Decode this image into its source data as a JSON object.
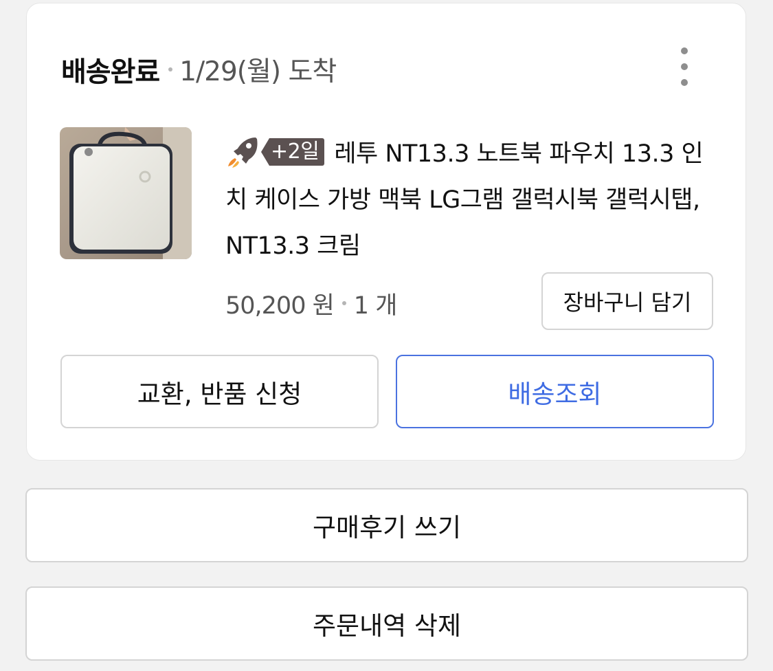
{
  "order": {
    "status": "배송완료",
    "arrival": "1/29(월) 도착",
    "more_icon": "more-vertical-icon"
  },
  "product": {
    "image_icon": "product-thumbnail",
    "rocket_icon": "rocket-icon",
    "badge": "+2일",
    "title": "레투 NT13.3 노트북 파우치 13.3 인치 케이스 가방 맥북 LG그램 갤럭시북 갤럭시탭, NT13.3 크림",
    "price": "50,200 원",
    "quantity": "1 개",
    "add_to_cart_label": "장바구니 담기"
  },
  "actions": {
    "exchange_return_label": "교환, 반품 신청",
    "track_delivery_label": "배송조회",
    "write_review_label": "구매후기 쓰기",
    "delete_order_label": "주문내역 삭제"
  },
  "colors": {
    "accent": "#3f6ce3",
    "badge_bg": "#5b5151",
    "page_bg": "#f2f2f2"
  }
}
